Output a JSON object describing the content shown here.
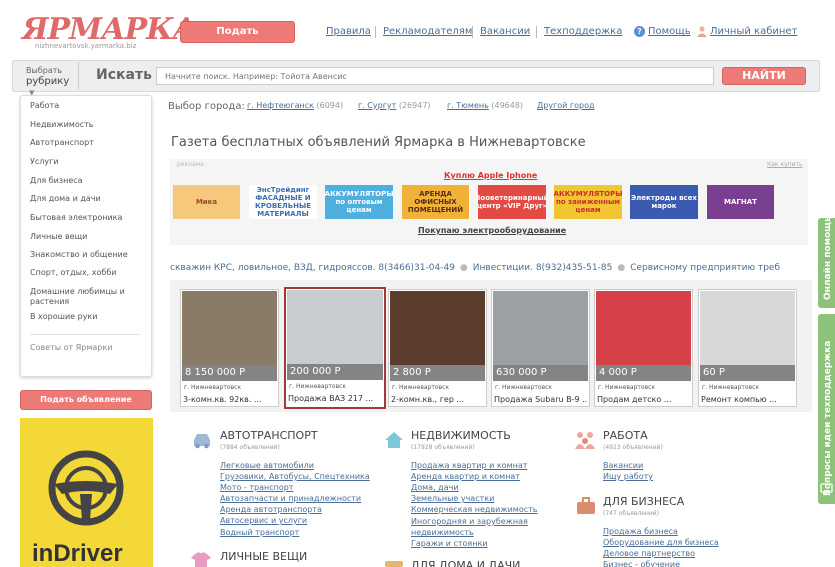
{
  "header": {
    "logo": "ЯРМАРКА",
    "logo_sub": "nizhnevartovsk.yarmarka.biz",
    "post_button": "Подать объявление",
    "nav": [
      "Правила",
      "Рекламодателям",
      "Вакансии",
      "Техподдержка"
    ],
    "help": "Помощь",
    "cabinet": "Личный кабинет",
    "help_icon": "question-icon",
    "user_icon": "user-icon"
  },
  "search": {
    "rubric_line1": "Выбрать",
    "rubric_line2": "рубрику",
    "label": "Искать",
    "placeholder": "Начните поиск. Например: Тойота Авенсис",
    "button": "НАЙТИ"
  },
  "sidebar": {
    "items": [
      "Работа",
      "Недвижимость",
      "Автотранспорт",
      "Услуги",
      "Для бизнеса",
      "Для дома и дачи",
      "Бытовая электроника",
      "Личные вещи",
      "Знакомство и общение",
      "Спорт, отдых, хобби",
      "Домашние любимцы и растения",
      "В хорошие руки"
    ],
    "tips": "Советы от Ярмарки",
    "post_button": "Подать объявление",
    "banner": "inDriver"
  },
  "city": {
    "label": "Выбор города:",
    "cities": [
      {
        "name": "г. Нефтеюганск",
        "count": "(6094)"
      },
      {
        "name": "г. Сургут",
        "count": "(26947)"
      },
      {
        "name": "г. Тюмень",
        "count": "(49648)"
      }
    ],
    "other": "Другой город"
  },
  "page_title": "Газета бесплатных объявлений Ярмарка в Нижневартовске",
  "ads": {
    "label": "реклама",
    "how": "Как купить",
    "buy_iphone": "Куплю Apple Iphone",
    "buy_el": "Покупаю электрооборудование",
    "banners": [
      {
        "text": "Мика",
        "bg": "#f6c87b",
        "color": "#a0452f"
      },
      {
        "text": "ЭнсТрейдинг ФАСАДНЫЕ И КРОВЕЛЬНЫЕ МАТЕРИАЛЫ",
        "bg": "#ffffff",
        "color": "#3b6fb0"
      },
      {
        "text": "АККУМУЛЯТОРЫ по оптовым ценам",
        "bg": "#4fb0e0",
        "color": "#ffffff"
      },
      {
        "text": "АРЕНДА ОФИСНЫХ ПОМЕЩЕНИЙ",
        "bg": "#f0b23a",
        "color": "#5a2c10"
      },
      {
        "text": "Зооветеринарный центр «VIP Друг»",
        "bg": "#e24a43",
        "color": "#ffffff"
      },
      {
        "text": "АККУМУЛЯТОРЫ по заниженным ценам",
        "bg": "#f2c532",
        "color": "#c9302c"
      },
      {
        "text": "Электроды всех марок",
        "bg": "#3b5bb0",
        "color": "#ffffff"
      },
      {
        "text": "МАГНАТ",
        "bg": "#7a3f90",
        "color": "#ffffff"
      }
    ]
  },
  "ticker": [
    "скважин КРС, ловильное, ВЗД, гидрояссов. 8(3466)31-04-49",
    "Инвестиции. 8(932)435-51-85",
    "Сервисному предприятию треб"
  ],
  "listings": [
    {
      "price": "8 150 000 Р",
      "city": "г. Нижневартовск",
      "title": "3-комн.кв. 92кв. ...",
      "img": "#8a7a68"
    },
    {
      "price": "200 000 Р",
      "city": "г. Нижневартовск",
      "title": "Продажа ВАЗ 217 ...",
      "img": "#c9ccd0"
    },
    {
      "price": "2 800 Р",
      "city": "г. Нижневартовск",
      "title": "2-комн.кв., гер ...",
      "img": "#5a3d2c"
    },
    {
      "price": "630 000 Р",
      "city": "г. Нижневартовск",
      "title": "Продажа Subaru В-9 ...",
      "img": "#9aa0a4"
    },
    {
      "price": "4 000 Р",
      "city": "г. Нижневартовск",
      "title": "Продам детско ...",
      "img": "#d64048"
    },
    {
      "price": "60 Р",
      "city": "г. Нижневартовск",
      "title": "Ремонт компью ...",
      "img": "#d8d8d8"
    }
  ],
  "categories": {
    "auto": {
      "title": "АВТОТРАНСПОРТ",
      "count": "(7884 объявлений)",
      "links": [
        "Легковые автомобили",
        "Грузовики, Автобусы, Спецтехника",
        "Мото - транспорт",
        "Автозапчасти и принадлежности",
        "Аренда автотранспорта",
        "Автосервис и услуги",
        "Водный транспорт"
      ],
      "icon": "car-icon"
    },
    "realty": {
      "title": "НЕДВИЖИМОСТЬ",
      "count": "(17928 объявлений)",
      "links": [
        "Продажа квартир и комнат",
        "Аренда квартир и комнат",
        "Дома, дачи",
        "Земельные участки",
        "Коммерческая недвижимость",
        "Иногородняя и зарубежная недвижимость",
        "Гаражи и стоянки"
      ],
      "icon": "house-icon"
    },
    "work": {
      "title": "РАБОТА",
      "count": "(4923 объявлений)",
      "links": [
        "Вакансии",
        "Ищу работу"
      ],
      "icon": "people-icon"
    },
    "business": {
      "title": "ДЛЯ БИЗНЕСА",
      "count": "(747 объявлений)",
      "links": [
        "Продажа бизнеса",
        "Оборудование для бизнеса",
        "Деловое партнерство",
        "Бизнес - обучение"
      ],
      "icon": "briefcase-icon"
    },
    "personal": {
      "title": "ЛИЧНЫЕ ВЕЩИ"
    },
    "home": {
      "title": "ДЛЯ ДОМА И ДАЧИ"
    }
  },
  "side_tabs": [
    "Онлайн помощь",
    "Вопросы идеи техподдержка"
  ]
}
